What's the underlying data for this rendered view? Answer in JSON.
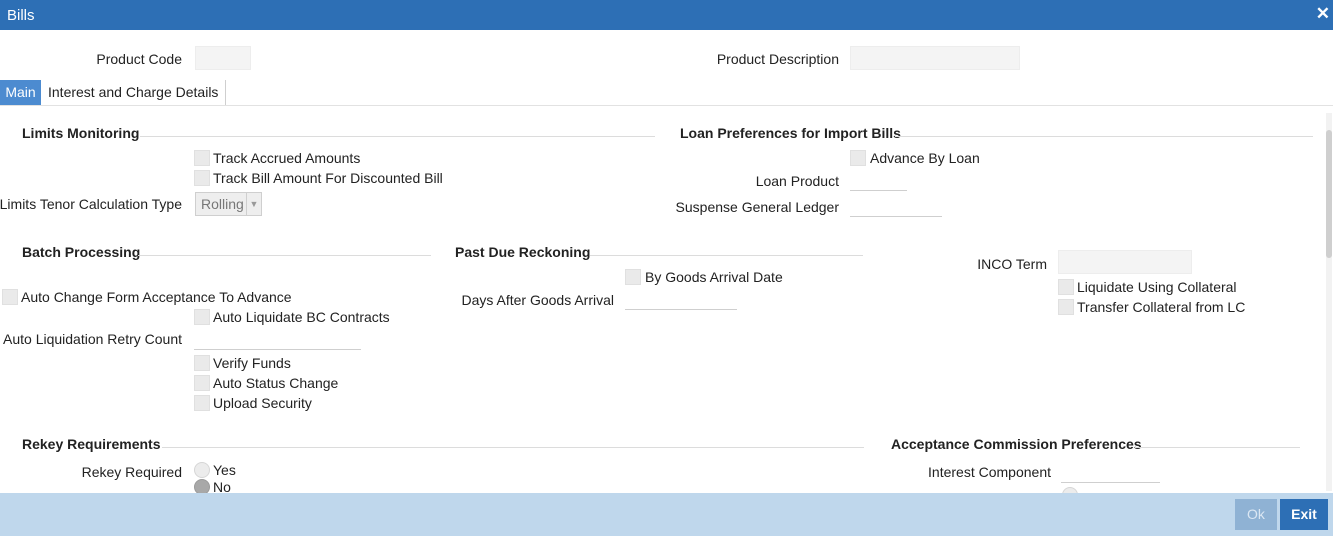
{
  "window": {
    "title": "Bills",
    "close_glyph": "✕"
  },
  "header": {
    "product_code_label": "Product Code",
    "product_code_value": "",
    "product_description_label": "Product Description",
    "product_description_value": ""
  },
  "tabs": [
    {
      "label": "Main",
      "active": true
    },
    {
      "label": "Interest and Charge Details",
      "active": false
    }
  ],
  "limits_monitoring": {
    "heading": "Limits Monitoring",
    "track_accrued_amounts": "Track Accrued Amounts",
    "track_bill_amount": "Track Bill Amount For Discounted Bill",
    "tenor_label": "Limits Tenor Calculation Type",
    "tenor_value": "Rolling"
  },
  "loan_preferences": {
    "heading": "Loan Preferences for Import Bills",
    "advance_by_loan": "Advance By Loan",
    "loan_product_label": "Loan Product",
    "loan_product_value": "",
    "suspense_gl_label": "Suspense General Ledger",
    "suspense_gl_value": ""
  },
  "batch_processing": {
    "heading": "Batch Processing",
    "auto_change_form": "Auto Change Form Acceptance To Advance",
    "auto_liquidate": "Auto Liquidate BC Contracts",
    "retry_count_label": "Auto Liquidation Retry Count",
    "retry_count_value": "",
    "verify_funds": "Verify Funds",
    "auto_status_change": "Auto Status Change",
    "upload_security": "Upload Security"
  },
  "past_due": {
    "heading": "Past Due Reckoning",
    "by_goods_arrival": "By Goods Arrival Date",
    "days_after_label": "Days After Goods Arrival",
    "days_after_value": ""
  },
  "inco": {
    "inco_term_label": "INCO Term",
    "inco_term_value": "",
    "liquidate_collateral": "Liquidate Using Collateral",
    "transfer_collateral": "Transfer Collateral from LC"
  },
  "rekey": {
    "heading": "Rekey Requirements",
    "rekey_required_label": "Rekey Required",
    "option_yes": "Yes",
    "option_no": "No",
    "selected": "No"
  },
  "acceptance_commission": {
    "heading": "Acceptance Commission Preferences",
    "interest_component_label": "Interest Component",
    "interest_component_value": ""
  },
  "footer": {
    "ok_label": "Ok",
    "exit_label": "Exit"
  }
}
